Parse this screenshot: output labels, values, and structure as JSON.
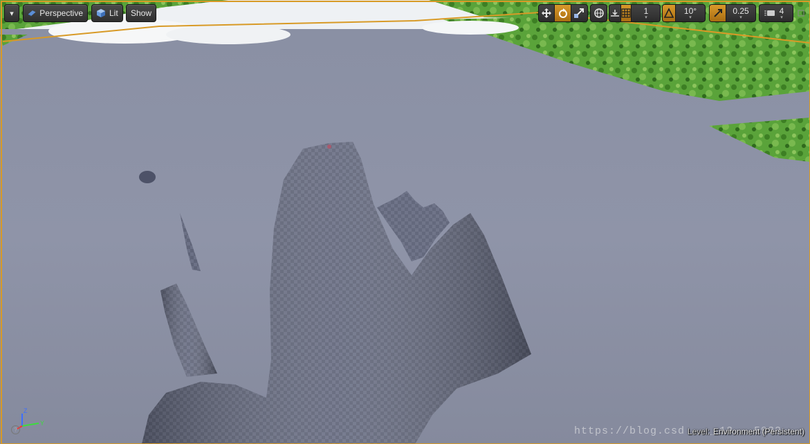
{
  "toolbar": {
    "menu_arrow": "▾",
    "view_mode_label": "Perspective",
    "lighting_label": "Lit",
    "show_label": "Show",
    "grid_snap_value": "1",
    "rotation_snap_value": "10°",
    "scale_snap_value": "0.25",
    "camera_speed_value": "4",
    "icons": [
      "viewport-options-icon",
      "perspective-icon",
      "lit-icon",
      "translate-icon",
      "rotate-icon",
      "scale-icon",
      "world-local-icon",
      "surface-snap-icon",
      "grid-snap-icon",
      "rotation-snap-icon",
      "scale-snap-icon",
      "camera-speed-icon",
      "maximize-icon"
    ]
  },
  "status": {
    "level_label": "Level:",
    "level_value": "Environment (Persistent)"
  },
  "watermark": "https://blog.csd   ____13___5932",
  "axis": {
    "z": "Z",
    "y": "Y",
    "help": "?"
  },
  "colors": {
    "accent": "#d89a26",
    "ground": "#8e93a6",
    "terrain": "#4a9a2e",
    "sky": "#eef1f4"
  }
}
